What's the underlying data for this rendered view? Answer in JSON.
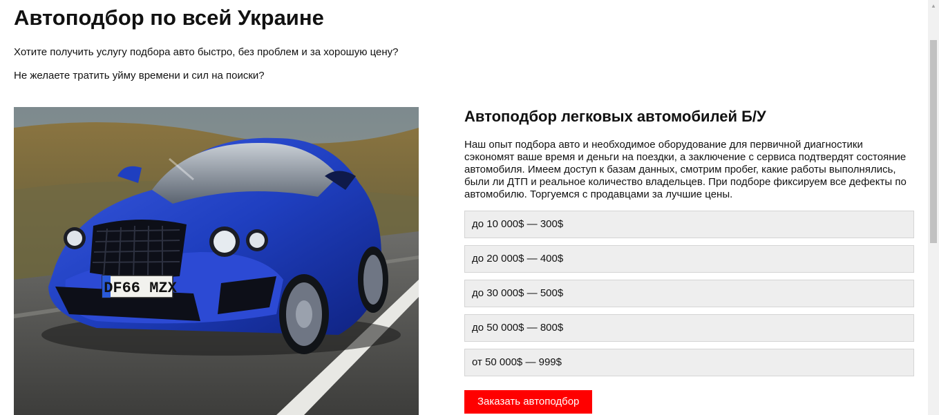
{
  "header": {
    "title": "Автоподбор по всей Украине",
    "question_1": "Хотите получить услугу подбора авто быстро, без проблем и за хорошую цену?",
    "question_2": "Не желаете тратить уйму времени и сил на поиски?"
  },
  "hero": {
    "plate_text": "DF66 MZX"
  },
  "service": {
    "subtitle": "Автоподбор легковых автомобилей Б/У",
    "description": "Наш опыт подбора авто и необходимое оборудование для первичной диагностики сэкономят ваше время и деньги на поездки, а заключение с сервиса подтвердят состояние автомобиля. Имеем доступ к базам данных, смотрим пробег, какие работы выполнялись, были ли ДТП и реальное количество владельцев. При подборе фиксируем все дефекты по автомобилю. Торгуемся с продавцами за лучшие цены.",
    "prices": [
      "до 10 000$ — 300$",
      "до 20 000$ — 400$",
      "до 30 000$ — 500$",
      "до 50 000$ — 800$",
      "от 50 000$ — 999$"
    ],
    "order_button": "Заказать автоподбор"
  },
  "colors": {
    "accent": "#ff0000",
    "price_row_bg": "#eeeeee",
    "car_body": "#1f3fc0"
  },
  "icons": {
    "scroll_up": "triangle-up"
  }
}
